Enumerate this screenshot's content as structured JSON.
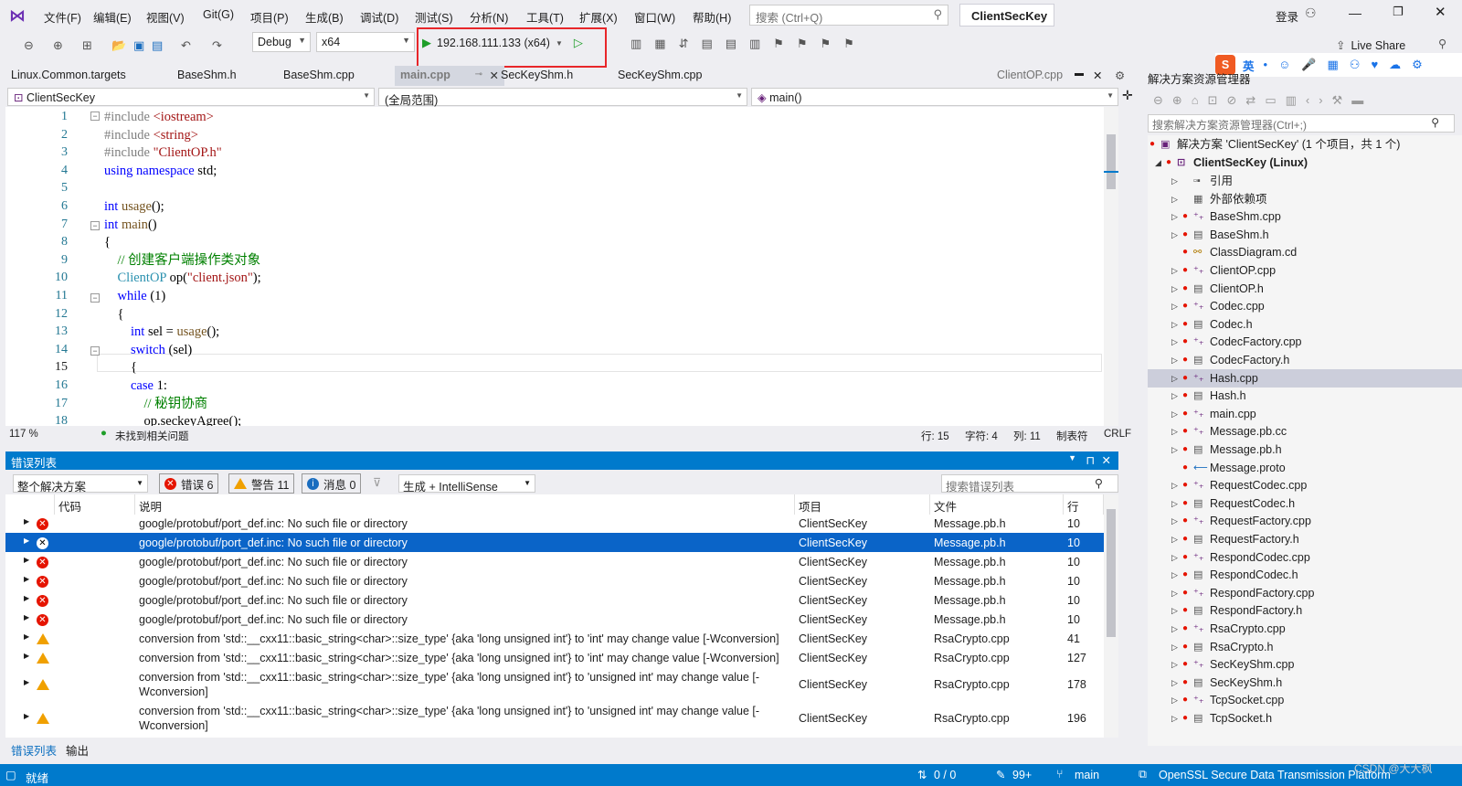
{
  "menu": [
    "文件(F)",
    "编辑(E)",
    "视图(V)",
    "Git(G)",
    "项目(P)",
    "生成(B)",
    "调试(D)",
    "测试(S)",
    "分析(N)",
    "工具(T)",
    "扩展(X)",
    "窗口(W)",
    "帮助(H)"
  ],
  "search_placeholder": "搜索 (Ctrl+Q)",
  "solution_title": "ClientSecKey",
  "login": "登录",
  "live_share": "Live Share",
  "toolbar": {
    "config": "Debug",
    "platform": "x64",
    "run_target": "192.168.111.133 (x64)"
  },
  "tabs": [
    {
      "label": "Linux.Common.targets"
    },
    {
      "label": "BaseShm.h"
    },
    {
      "label": "BaseShm.cpp"
    },
    {
      "label": "main.cpp",
      "active": true
    },
    {
      "label": "SecKeyShm.h"
    },
    {
      "label": "SecKeyShm.cpp"
    },
    {
      "label": "ClientOP.cpp"
    }
  ],
  "nav": {
    "project": "ClientSecKey",
    "scope": "(全局范围)",
    "member": "main()"
  },
  "code_lines": [
    {
      "n": "1",
      "html": "<span class='pp'>#include </span><span class='str'>&lt;iostream&gt;</span>"
    },
    {
      "n": "2",
      "html": "<span class='pp'>#include </span><span class='str'>&lt;string&gt;</span>"
    },
    {
      "n": "3",
      "html": "<span class='pp'>#include </span><span class='str'>\"ClientOP.h\"</span>"
    },
    {
      "n": "4",
      "html": "<span class='kw'>using namespace</span> std;"
    },
    {
      "n": "5",
      "html": ""
    },
    {
      "n": "6",
      "html": "<span class='kw'>int</span> <span class='fn'>usage</span>();"
    },
    {
      "n": "7",
      "html": "<span class='kw'>int</span> <span class='fn'>main</span>()"
    },
    {
      "n": "8",
      "html": "{"
    },
    {
      "n": "9",
      "html": "    <span class='cm'>// 创建客户端操作类对象</span>"
    },
    {
      "n": "10",
      "html": "    <span class='ty'>ClientOP</span> op(<span class='str'>\"client.json\"</span>);"
    },
    {
      "n": "11",
      "html": "    <span class='kw'>while</span> (1)"
    },
    {
      "n": "12",
      "html": "    {"
    },
    {
      "n": "13",
      "html": "        <span class='kw'>int</span> sel = <span class='fn'>usage</span>();"
    },
    {
      "n": "14",
      "html": "        <span class='kw'>switch</span> (sel)"
    },
    {
      "n": "15",
      "html": "        {"
    },
    {
      "n": "16",
      "html": "        <span class='kw'>case</span> 1:"
    },
    {
      "n": "17",
      "html": "            <span class='cm'>// 秘钥协商</span>"
    },
    {
      "n": "18",
      "html": "            op.seckeyAgree();"
    }
  ],
  "editor_status": {
    "zoom": "117 %",
    "issues": "未找到相关问题",
    "line": "行: 15",
    "char": "字符: 4",
    "col": "列: 11",
    "tabs": "制表符",
    "eol": "CRLF"
  },
  "error_list": {
    "title": "错误列表",
    "scope": "整个解决方案",
    "errors": "错误 6",
    "warnings": "警告 11",
    "messages": "消息 0",
    "build": "生成 + IntelliSense",
    "search": "搜索错误列表",
    "columns": [
      "代码",
      "说明",
      "项目",
      "文件",
      "行"
    ],
    "rows": [
      {
        "type": "error",
        "desc": "google/protobuf/port_def.inc: No such file or directory",
        "project": "ClientSecKey",
        "file": "Message.pb.h",
        "line": "10"
      },
      {
        "type": "error",
        "desc": "google/protobuf/port_def.inc: No such file or directory",
        "project": "ClientSecKey",
        "file": "Message.pb.h",
        "line": "10",
        "selected": true
      },
      {
        "type": "error",
        "desc": "google/protobuf/port_def.inc: No such file or directory",
        "project": "ClientSecKey",
        "file": "Message.pb.h",
        "line": "10"
      },
      {
        "type": "error",
        "desc": "google/protobuf/port_def.inc: No such file or directory",
        "project": "ClientSecKey",
        "file": "Message.pb.h",
        "line": "10"
      },
      {
        "type": "error",
        "desc": "google/protobuf/port_def.inc: No such file or directory",
        "project": "ClientSecKey",
        "file": "Message.pb.h",
        "line": "10"
      },
      {
        "type": "error",
        "desc": "google/protobuf/port_def.inc: No such file or directory",
        "project": "ClientSecKey",
        "file": "Message.pb.h",
        "line": "10"
      },
      {
        "type": "warning",
        "desc": "conversion from 'std::__cxx11::basic_string<char>::size_type' {aka 'long unsigned int'} to 'int' may change value [-Wconversion]",
        "project": "ClientSecKey",
        "file": "RsaCrypto.cpp",
        "line": "41"
      },
      {
        "type": "warning",
        "desc": "conversion from 'std::__cxx11::basic_string<char>::size_type' {aka 'long unsigned int'} to 'int' may change value [-Wconversion]",
        "project": "ClientSecKey",
        "file": "RsaCrypto.cpp",
        "line": "127"
      },
      {
        "type": "warning",
        "desc": "conversion from 'std::__cxx11::basic_string<char>::size_type' {aka 'long unsigned int'} to 'unsigned int' may change value [-Wconversion]",
        "project": "ClientSecKey",
        "file": "RsaCrypto.cpp",
        "line": "178"
      },
      {
        "type": "warning",
        "desc": "conversion from 'std::__cxx11::basic_string<char>::size_type' {aka 'long unsigned int'} to 'unsigned int' may change value [-Wconversion]",
        "project": "ClientSecKey",
        "file": "RsaCrypto.cpp",
        "line": "196"
      }
    ],
    "bottom_tabs": [
      "错误列表",
      "输出"
    ]
  },
  "solution_explorer": {
    "title": "解决方案资源管理器",
    "search": "搜索解决方案资源管理器(Ctrl+;)",
    "solution": "解决方案 'ClientSecKey' (1 个项目，共 1 个)",
    "project": "ClientSecKey (Linux)",
    "items": [
      "引用",
      "外部依赖项",
      "BaseShm.cpp",
      "BaseShm.h",
      "ClassDiagram.cd",
      "ClientOP.cpp",
      "ClientOP.h",
      "Codec.cpp",
      "Codec.h",
      "CodecFactory.cpp",
      "CodecFactory.h",
      "Hash.cpp",
      "Hash.h",
      "main.cpp",
      "Message.pb.cc",
      "Message.pb.h",
      "Message.proto",
      "RequestCodec.cpp",
      "RequestCodec.h",
      "RequestFactory.cpp",
      "RequestFactory.h",
      "RespondCodec.cpp",
      "RespondCodec.h",
      "RespondFactory.cpp",
      "RespondFactory.h",
      "RsaCrypto.cpp",
      "RsaCrypto.h",
      "SecKeyShm.cpp",
      "SecKeyShm.h",
      "TcpSocket.cpp",
      "TcpSocket.h"
    ],
    "selected": "Hash.cpp"
  },
  "ime": "英",
  "statusbar": {
    "ready": "就绪",
    "sync": "0 / 0",
    "edits": "99+",
    "branch": "main",
    "repo": "OpenSSL Secure Data Transmission Platform",
    "watermark": "CSDN @大大枫"
  },
  "colors": {
    "accent": "#007acc",
    "error": "#e51400",
    "warning": "#f0a000",
    "selection": "#0a64c8",
    "highlight_box": "#e8262a"
  }
}
